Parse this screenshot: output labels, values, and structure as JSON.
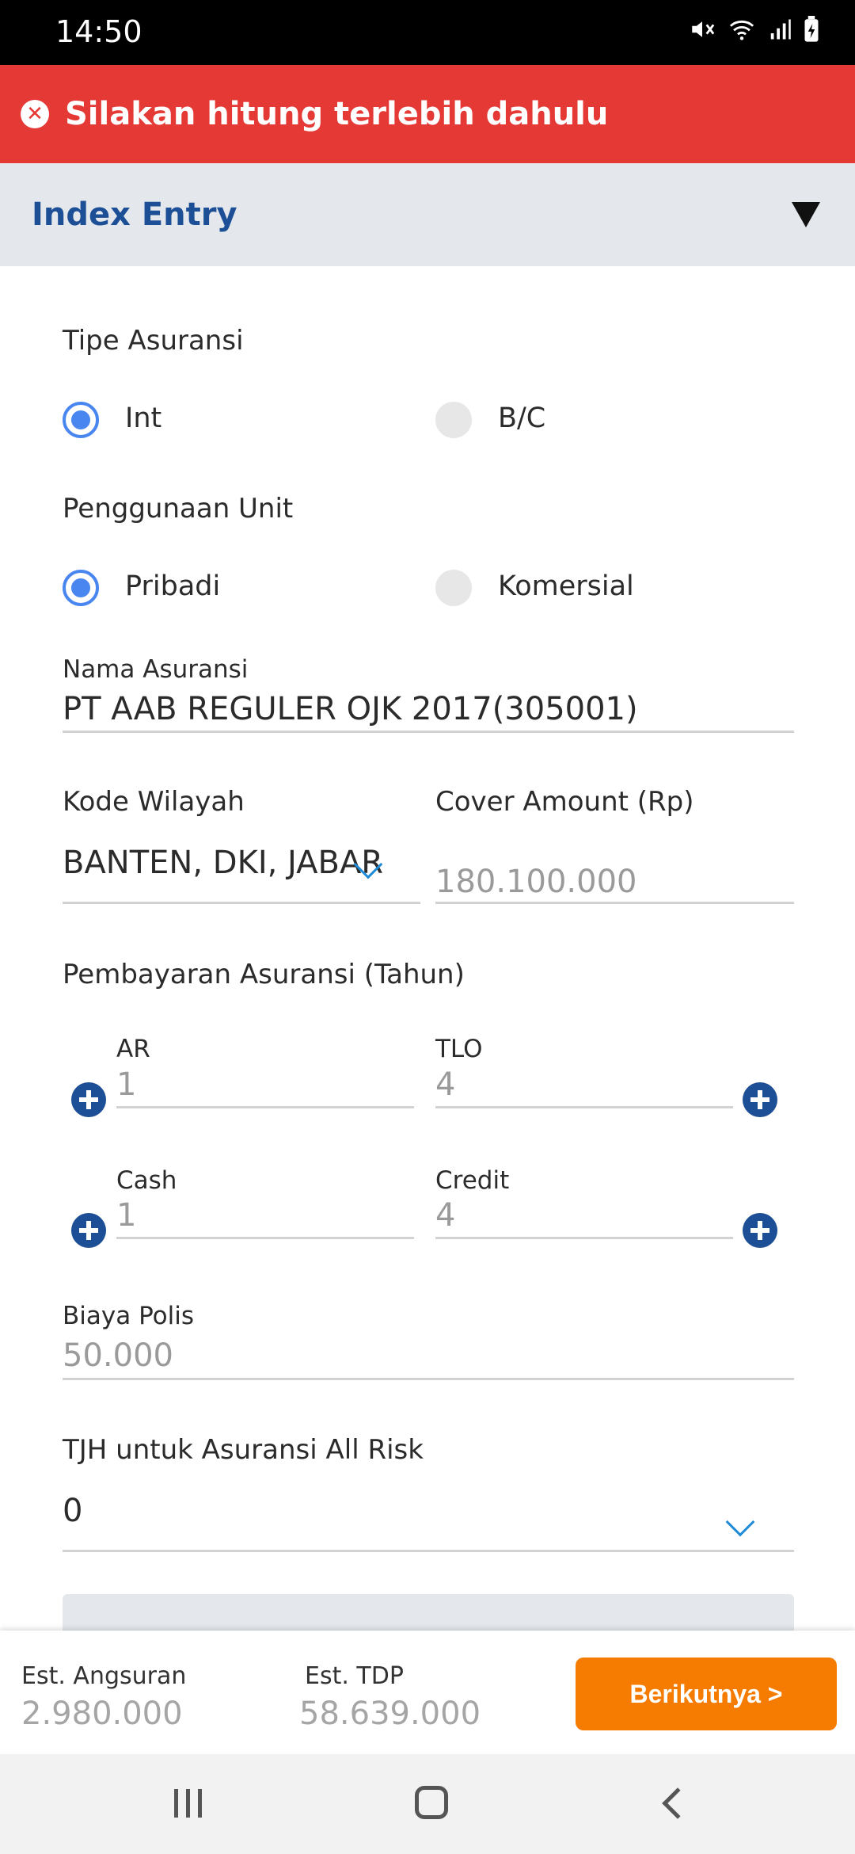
{
  "status_bar": {
    "time": "14:50",
    "icons": [
      "mute-icon",
      "wifi-icon",
      "signal-icon",
      "battery-icon"
    ]
  },
  "alert": {
    "message": "Silakan hitung terlebih dahulu",
    "icon": "error-x-icon",
    "color": "#e53935"
  },
  "section": {
    "title": "Index Entry",
    "color": "#1d4f96"
  },
  "form": {
    "tipe_asuransi": {
      "label": "Tipe Asuransi",
      "options": [
        "Int",
        "B/C"
      ],
      "selected": "Int"
    },
    "penggunaan_unit": {
      "label": "Penggunaan Unit",
      "options": [
        "Pribadi",
        "Komersial"
      ],
      "selected": "Pribadi"
    },
    "nama_asuransi": {
      "label": "Nama Asuransi",
      "value": "PT AAB REGULER OJK 2017(305001)"
    },
    "kode_wilayah": {
      "label": "Kode Wilayah",
      "value": "BANTEN, DKI, JABAR"
    },
    "cover_amount": {
      "label": "Cover Amount (Rp)",
      "value": "180.100.000"
    },
    "pembayaran": {
      "label": "Pembayaran Asuransi (Tahun)",
      "ar": {
        "label": "AR",
        "value": "1"
      },
      "tlo": {
        "label": "TLO",
        "value": "4"
      },
      "cash": {
        "label": "Cash",
        "value": "1"
      },
      "credit": {
        "label": "Credit",
        "value": "4"
      }
    },
    "biaya_polis": {
      "label": "Biaya Polis",
      "value": "50.000"
    },
    "tjh": {
      "label": "TJH untuk Asuransi All Risk",
      "value": "0"
    }
  },
  "footer": {
    "est_angsuran_label": "Est. Angsuran",
    "est_angsuran_value": "2.980.000",
    "est_tdp_label": "Est. TDP",
    "est_tdp_value": "58.639.000",
    "next_button": "Berikutnya >",
    "accent": "#f57c00"
  }
}
